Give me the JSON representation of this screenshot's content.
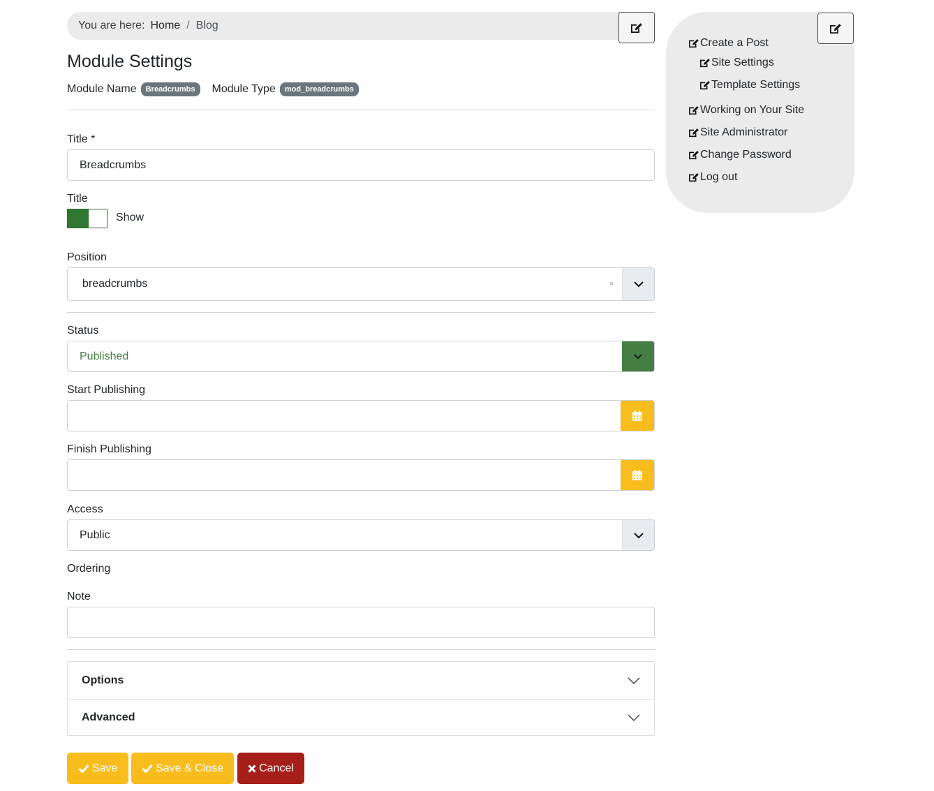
{
  "breadcrumb": {
    "prefix": "You are here:",
    "items": [
      {
        "label": "Home"
      },
      {
        "label": "Blog"
      }
    ],
    "separator": "/"
  },
  "edit_icon": "edit-square-pencil-icon",
  "sidebar": {
    "items": [
      {
        "label": "Create a Post",
        "indent": false
      },
      {
        "label": "Site Settings",
        "indent": true
      },
      {
        "label": "Template Settings",
        "indent": true
      },
      {
        "label": "Working on Your Site",
        "indent": false
      },
      {
        "label": "Site Administrator",
        "indent": false
      },
      {
        "label": "Change Password",
        "indent": false
      },
      {
        "label": "Log out",
        "indent": false
      }
    ]
  },
  "page": {
    "title": "Module Settings",
    "module_name_label": "Module Name",
    "module_name_value": "Breadcrumbs",
    "module_type_label": "Module Type",
    "module_type_value": "mod_breadcrumbs"
  },
  "form": {
    "title_label": "Title *",
    "title_value": "Breadcrumbs",
    "show_title_label": "Title",
    "show_title_toggle": {
      "state": "on",
      "label": "Show"
    },
    "position_label": "Position",
    "position_value": "breadcrumbs",
    "position_clear": "×",
    "status_label": "Status",
    "status_value": "Published",
    "start_publishing_label": "Start Publishing",
    "start_publishing_value": "",
    "finish_publishing_label": "Finish Publishing",
    "finish_publishing_value": "",
    "access_label": "Access",
    "access_value": "Public",
    "ordering_label": "Ordering",
    "note_label": "Note",
    "note_value": ""
  },
  "accordion": [
    {
      "title": "Options"
    },
    {
      "title": "Advanced"
    }
  ],
  "actions": {
    "save": "Save",
    "save_close": "Save & Close",
    "cancel": "Cancel"
  },
  "colors": {
    "primary_yellow": "#f8bc1d",
    "cancel_red": "#a51f18",
    "published_green": "#457d43",
    "toggle_green": "#2f7632",
    "panel_gray": "#ebebeb"
  }
}
